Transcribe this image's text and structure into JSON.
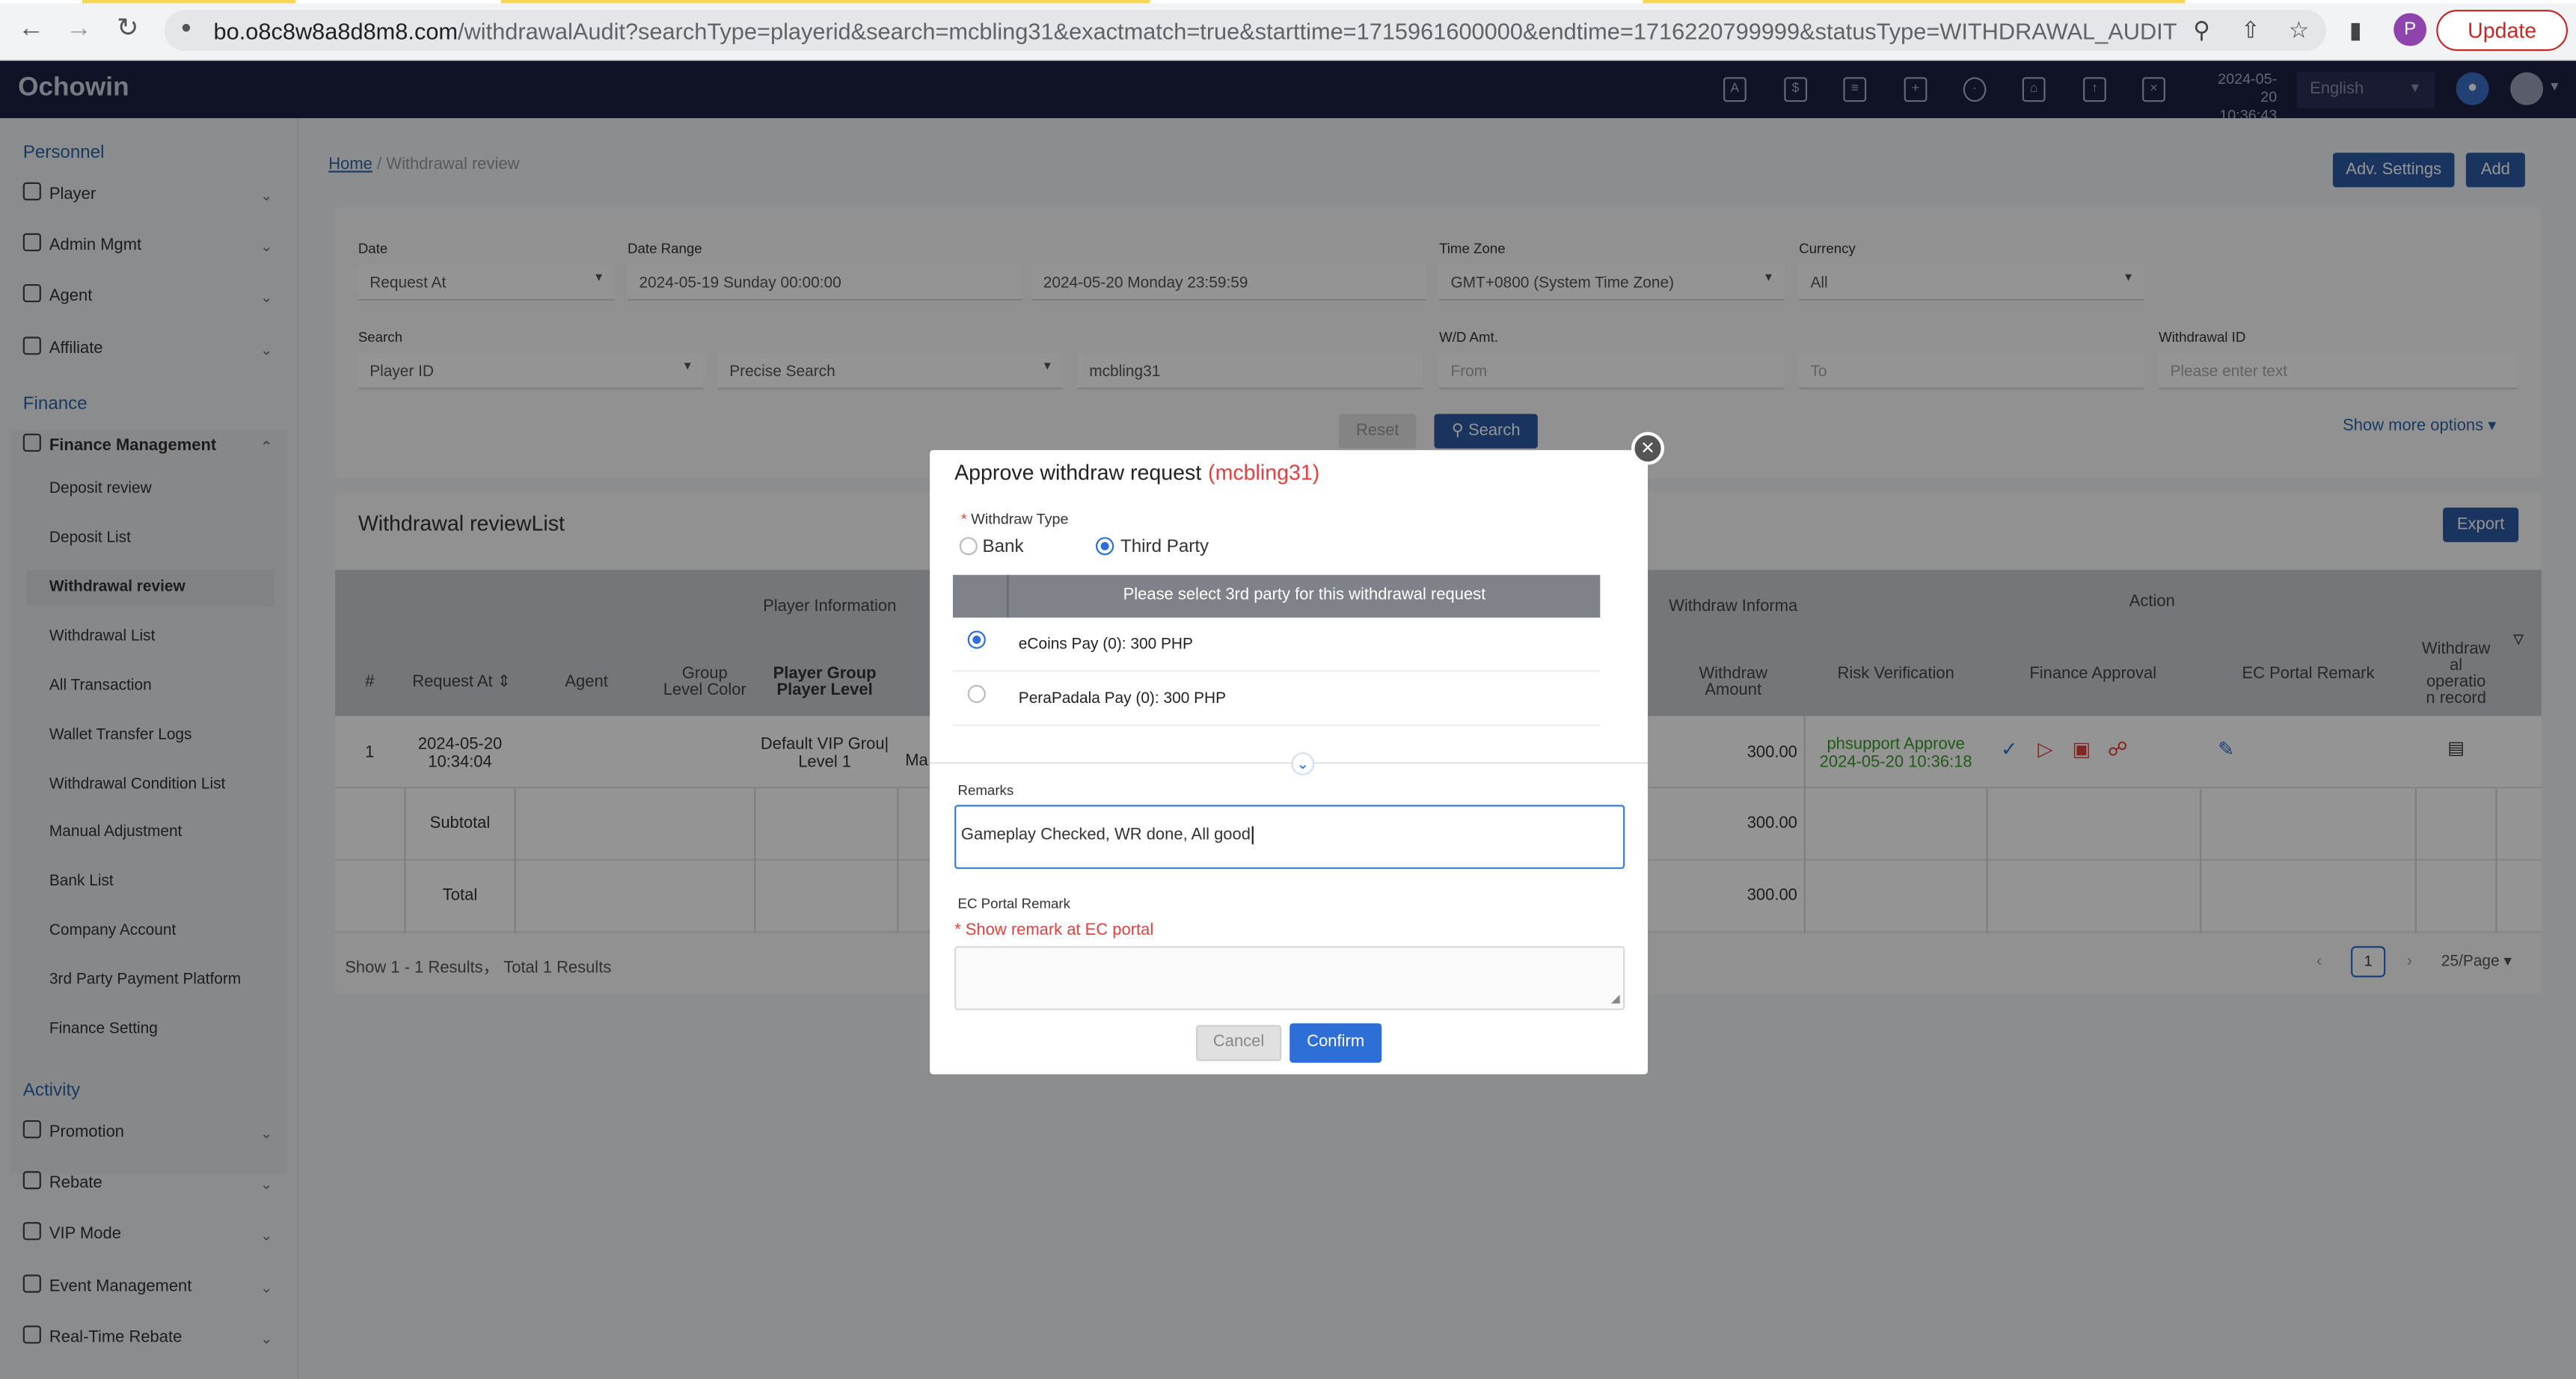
{
  "browser": {
    "url_host": "bo.o8c8w8a8d8m8.com",
    "url_path": "/withdrawalAudit?searchType=playerid&search=mcbling31&exactmatch=true&starttime=1715961600000&endtime=1716220799999&statusType=WITHDRAWAL_AUDIT",
    "profile_initial": "P",
    "update_label": "Update"
  },
  "app": {
    "brand": "Ochowin",
    "time_line1": "2024-05-20",
    "time_line2": "10:36:43",
    "language": "English"
  },
  "sidebar": {
    "sections": [
      "Personnel",
      "Finance",
      "Activity"
    ],
    "personnel_items": [
      "Player",
      "Admin Mgmt",
      "Agent",
      "Affiliate"
    ],
    "finance_group": "Finance Management",
    "finance_items": [
      "Deposit review",
      "Deposit List",
      "Withdrawal review",
      "Withdrawal List",
      "All Transaction",
      "Wallet Transfer Logs",
      "Withdrawal Condition List",
      "Manual Adjustment",
      "Bank List",
      "Company Account",
      "3rd Party Payment Platform",
      "Finance Setting"
    ],
    "activity_items": [
      "Promotion",
      "Rebate",
      "VIP Mode",
      "Event Management",
      "Real-Time Rebate"
    ]
  },
  "breadcrumb": {
    "home": "Home",
    "current": "Withdrawal review"
  },
  "header_buttons": {
    "adv": "Adv. Settings",
    "add": "Add"
  },
  "filters": {
    "date_label": "Date",
    "date_value": "Request At",
    "range_label": "Date Range",
    "range_start": "2024-05-19 Sunday 00:00:00",
    "range_end": "2024-05-20 Monday 23:59:59",
    "tz_label": "Time Zone",
    "tz_value": "GMT+0800 (System Time Zone)",
    "currency_label": "Currency",
    "currency_value": "All",
    "search_label": "Search",
    "search_type": "Player ID",
    "match_type": "Precise Search",
    "search_value": "mcbling31",
    "wd_label": "W/D Amt.",
    "wd_from": "From",
    "wd_to": "To",
    "wid_label": "Withdrawal ID",
    "wid_placeholder": "Please enter text",
    "reset": "Reset",
    "search": "Search",
    "more": "Show more options"
  },
  "list": {
    "title": "Withdrawal reviewList",
    "export": "Export",
    "group_headers": {
      "player": "Player Information",
      "withdraw": "Withdraw Informa",
      "action": "Action"
    },
    "columns": {
      "num": "#",
      "request": "Request At",
      "agent": "Agent",
      "glc1": "Group",
      "glc2": "Level Color",
      "pg1": "Player Group",
      "pg2": "Player Level",
      "amt1": "Withdraw",
      "amt2": "Amount",
      "risk": "Risk Verification",
      "fin": "Finance Approval",
      "ec": "EC Portal Remark",
      "wo1": "Withdraw",
      "wo2": "al",
      "wo3": "operatio",
      "wo4": "n record"
    },
    "row": {
      "num": "1",
      "date": "2024-05-20",
      "time": "10:34:04",
      "group1": "Default VIP Grou|",
      "group2": "Level 1",
      "frag": "Ma",
      "amount": "300.00",
      "risk1": "phsupport Approve",
      "risk2": "2024-05-20 10:36:18"
    },
    "subtotal_label": "Subtotal",
    "subtotal_amount": "300.00",
    "total_label": "Total",
    "total_amount": "300.00",
    "results": "Show 1 - 1 Results， Total 1 Results",
    "page": "1",
    "page_size": "25/Page"
  },
  "modal": {
    "title": "Approve withdraw request",
    "player_id": "(mcbling31)",
    "withdraw_type_label": "Withdraw Type",
    "type_bank": "Bank",
    "type_third": "Third Party",
    "selected_type": "Third Party",
    "party_header": "Please select 3rd party for this withdrawal request",
    "parties": [
      "eCoins Pay (0): 300 PHP",
      "PeraPadala Pay (0): 300 PHP"
    ],
    "selected_party": "eCoins Pay (0): 300 PHP",
    "remarks_label": "Remarks",
    "remarks_value": "Gameplay Checked, WR done, All good",
    "ec_label": "EC Portal Remark",
    "ec_note": "* Show remark at EC portal",
    "cancel": "Cancel",
    "confirm": "Confirm"
  },
  "colors": {
    "brand_bar": "#1d2142",
    "accent": "#2d6fd6",
    "danger": "#e04141",
    "approve_green": "#3a9a2b"
  }
}
